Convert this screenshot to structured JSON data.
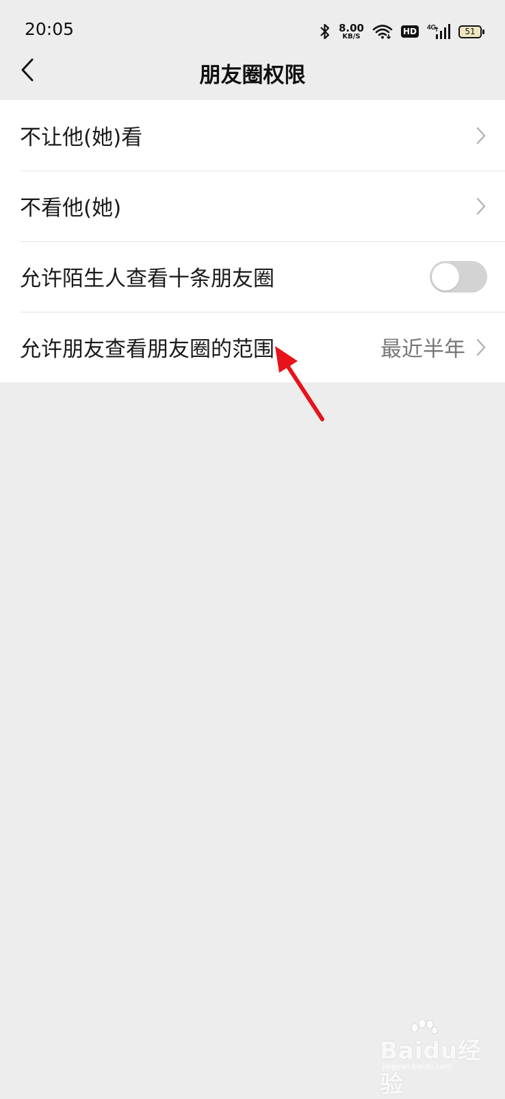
{
  "status_bar": {
    "time": "20:05",
    "speed_value": "8.00",
    "speed_unit": "KB/S",
    "hd_label": "HD",
    "network": "4G",
    "battery": "51",
    "icons": [
      "bluetooth-icon",
      "wifi-icon",
      "hd-icon",
      "signal-icon",
      "battery-icon"
    ]
  },
  "nav": {
    "title": "朋友圈权限",
    "back_icon": "back-arrow-icon"
  },
  "settings": {
    "items": [
      {
        "label": "不让他(她)看",
        "type": "link"
      },
      {
        "label": "不看他(她)",
        "type": "link"
      },
      {
        "label": "允许陌生人查看十条朋友圈",
        "type": "toggle",
        "enabled": false
      },
      {
        "label": "允许朋友查看朋友圈的范围",
        "type": "link",
        "value": "最近半年"
      }
    ]
  },
  "watermark": {
    "text": "Baidu经验",
    "url": "jingyan.baidu.com"
  },
  "colors": {
    "background": "#ededed",
    "card": "#ffffff",
    "annotation_arrow": "#e8131a",
    "toggle_off": "#d3d3d3"
  }
}
